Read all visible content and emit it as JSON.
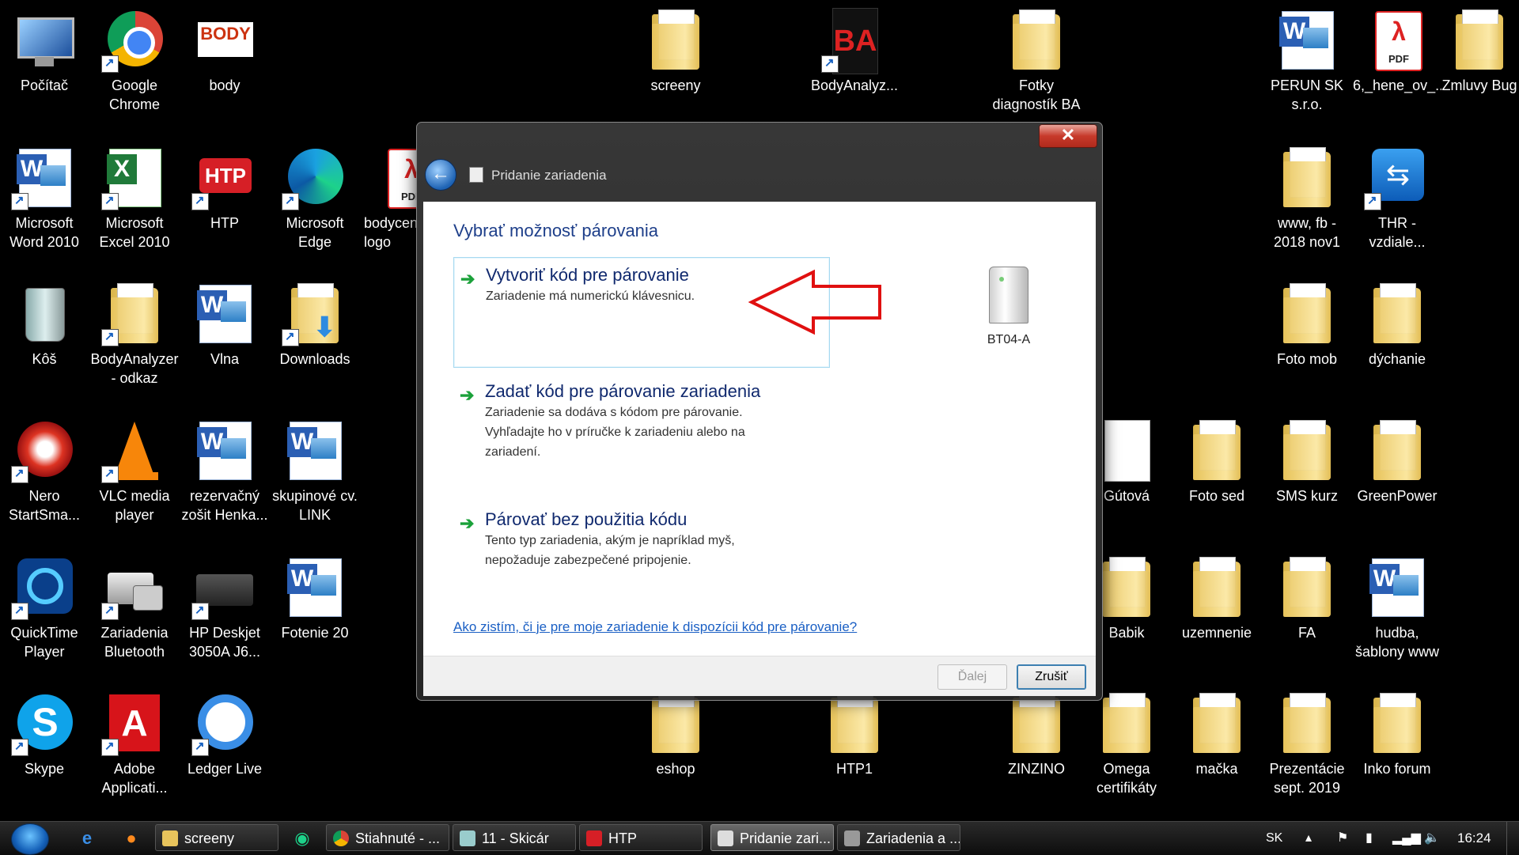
{
  "desktop": {
    "icons": [
      {
        "label": "Počítač"
      },
      {
        "label": "Google\nChrome"
      },
      {
        "label": "body"
      },
      {
        "label": "screeny"
      },
      {
        "label": "BodyAnalyz..."
      },
      {
        "label": "Fotky\ndiagnostík BA"
      },
      {
        "label": "PERUN SK\ns.r.o."
      },
      {
        "label": "6,_hene_ov_..."
      },
      {
        "label": "Zmluvy Bug"
      },
      {
        "label": "Microsoft\nWord 2010"
      },
      {
        "label": "Microsoft\nExcel 2010"
      },
      {
        "label": "HTP"
      },
      {
        "label": "Microsoft\nEdge"
      },
      {
        "label": "bodycen\nlogo"
      },
      {
        "label": "www, fb -\n2018 nov1"
      },
      {
        "label": "THR -\nvzdiale..."
      },
      {
        "label": "Kôš"
      },
      {
        "label": "BodyAnalyzer\n- odkaz"
      },
      {
        "label": "Vlna"
      },
      {
        "label": "Downloads"
      },
      {
        "label": "Foto mob"
      },
      {
        "label": "dýchanie"
      },
      {
        "label": "Nero\nStartSma..."
      },
      {
        "label": "VLC media\nplayer"
      },
      {
        "label": "rezervačný\nzošit Henka..."
      },
      {
        "label": "skupinové cv.\nLINK"
      },
      {
        "label": "Gútová"
      },
      {
        "label": "Foto sed"
      },
      {
        "label": "SMS kurz"
      },
      {
        "label": "GreenPower"
      },
      {
        "label": "QuickTime\nPlayer"
      },
      {
        "label": "Zariadenia\nBluetooth"
      },
      {
        "label": "HP Deskjet\n3050A J6..."
      },
      {
        "label": "Fotenie 20"
      },
      {
        "label": "Babik"
      },
      {
        "label": "uzemnenie"
      },
      {
        "label": "FA"
      },
      {
        "label": "hudba,\nšablony www"
      },
      {
        "label": "Skype"
      },
      {
        "label": "Adobe\nApplicati..."
      },
      {
        "label": "Ledger Live"
      },
      {
        "label": "eshop"
      },
      {
        "label": "HTP1"
      },
      {
        "label": "ZINZINO"
      },
      {
        "label": "Omega\ncertifikáty"
      },
      {
        "label": "mačka"
      },
      {
        "label": "Prezentácie\nsept. 2019"
      },
      {
        "label": "Inko forum"
      }
    ]
  },
  "dialog": {
    "close_label": "✕",
    "title": "Pridanie zariadenia",
    "heading": "Vybrať možnosť párovania",
    "options": [
      {
        "title": "Vytvoriť kód pre párovanie",
        "desc": "Zariadenie má numerickú klávesnicu."
      },
      {
        "title": "Zadať kód pre párovanie zariadenia",
        "desc": "Zariadenie sa dodáva s kódom pre párovanie.\nVyhľadajte ho v príručke k zariadeniu alebo na\nzariadení."
      },
      {
        "title": "Párovať bez použitia kódu",
        "desc": "Tento typ zariadenia, akým je napríklad myš,\nnepožaduje zabezpečené pripojenie."
      }
    ],
    "device_name": "BT04-A",
    "help_link": "Ako zistím, či je pre moje zariadenie k dispozícii kód pre párovanie?",
    "next_label": "Ďalej",
    "cancel_label": "Zrušiť"
  },
  "taskbar": {
    "buttons": [
      {
        "label": "screeny"
      },
      {
        "label": "Stiahnuté - ..."
      },
      {
        "label": "11 - Skicár"
      },
      {
        "label": "HTP"
      },
      {
        "label": "Pridanie zari..."
      },
      {
        "label": "Zariadenia a ..."
      }
    ],
    "language": "SK",
    "time": "16:24"
  },
  "colors": {
    "accent_heading": "#1e3f8a",
    "option_arrow": "#1ba13a",
    "annotation_arrow": "#e01010",
    "link": "#1a5fc4"
  }
}
